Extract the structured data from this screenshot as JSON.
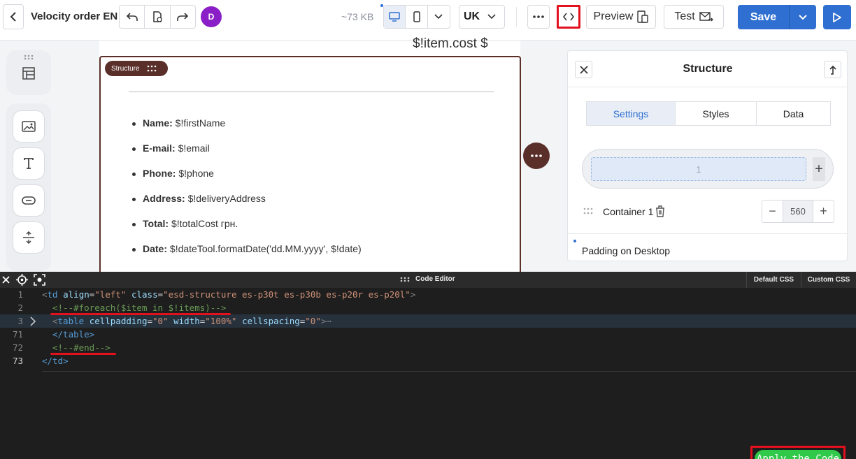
{
  "header": {
    "title": "Velocity order EN",
    "avatar_initial": "D",
    "size": "~73 KB",
    "language": "UK",
    "preview_label": "Preview",
    "test_label": "Test",
    "save_label": "Save"
  },
  "canvas": {
    "item_cost_text": "$!item.cost $",
    "structure_tag": "Structure",
    "order_fields": [
      {
        "label": "Name:",
        "value": " $!firstName"
      },
      {
        "label": "E-mail:",
        "value": " $!email"
      },
      {
        "label": "Phone:",
        "value": " $!phone"
      },
      {
        "label": "Address:",
        "value": " $!deliveryAddress"
      },
      {
        "label": "Total:",
        "value": " $!totalCost грн."
      },
      {
        "label": "Date:",
        "value": " $!dateTool.formatDate('dd.MM.yyyy', $!date)"
      }
    ]
  },
  "panel": {
    "title": "Structure",
    "tabs": [
      "Settings",
      "Styles",
      "Data"
    ],
    "active_tab": "Settings",
    "column_cell": "1",
    "container_label": "Container 1",
    "container_width": "560",
    "padding_label": "Padding on Desktop"
  },
  "editor": {
    "title": "Code Editor",
    "tabs": [
      "Default CSS",
      "Custom CSS"
    ],
    "apply_label": "Apply the Code",
    "lines": [
      {
        "num": "1"
      },
      {
        "num": "2"
      },
      {
        "num": "3"
      },
      {
        "num": "71"
      },
      {
        "num": "72"
      },
      {
        "num": "73"
      }
    ],
    "line1": {
      "open": "<",
      "tag": "td",
      "a1": " align",
      "eq": "=",
      "v1": "\"left\"",
      "a2": " class",
      "v2": "\"esd-structure es-p30t es-p30b es-p20r es-p20l\"",
      "close": ">"
    },
    "line2": "<!--#foreach($item in $!items)-->",
    "line3": {
      "open": "<",
      "tag": "table",
      "a1": " cellpadding",
      "v1": "\"0\"",
      "a2": " width",
      "v2": "\"100%\"",
      "a3": " cellspacing",
      "v3": "\"0\"",
      "close": ">",
      "ellipsis": "⋯"
    },
    "line71": "</table>",
    "line72": "<!--#end-->",
    "line73": "</td>"
  },
  "colors": {
    "accent": "#2f6fd1",
    "structure": "#5a2f2a",
    "highlight_red": "#e3101d",
    "apply_green": "#31c94a"
  }
}
